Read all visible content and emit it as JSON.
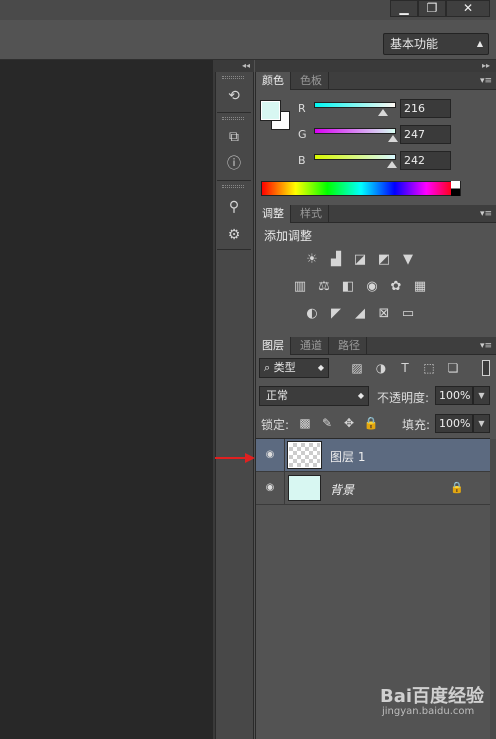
{
  "window": {
    "min_label": "▁",
    "max_label": "❐",
    "close_label": "✕"
  },
  "options_bar": {
    "workspace": "基本功能"
  },
  "color_panel": {
    "tabs": [
      "颜色",
      "色板"
    ],
    "foreground_hex": "#d8f7f2",
    "background_hex": "#ffffff",
    "channels": [
      {
        "label": "R",
        "value": "216",
        "level": 0.847,
        "gradient": "linear-gradient(to right, #00f7f2, #fff7f2)"
      },
      {
        "label": "G",
        "value": "247",
        "level": 0.969,
        "gradient": "linear-gradient(to right, #d800f2, #d8fff2)"
      },
      {
        "label": "B",
        "value": "242",
        "level": 0.949,
        "gradient": "linear-gradient(to right, #d8f700, #d8f7ff)"
      }
    ]
  },
  "adjustments_panel": {
    "tabs": [
      "调整",
      "样式"
    ],
    "title": "添加调整",
    "icons": [
      [
        "brightness-icon",
        "levels-icon",
        "curves-icon",
        "exposure-icon",
        "vibrance-icon"
      ],
      [
        "hue-saturation-icon",
        "color-balance-icon",
        "black-white-icon",
        "photo-filter-icon",
        "channel-mixer-icon",
        "color-lookup-icon"
      ],
      [
        "invert-icon",
        "posterize-icon",
        "threshold-icon",
        "selective-color-icon",
        "gradient-map-icon"
      ]
    ]
  },
  "layers_panel": {
    "tabs": [
      "图层",
      "通道",
      "路径"
    ],
    "filter_type": "类型",
    "blend_mode": "正常",
    "opacity_label": "不透明度:",
    "opacity_value": "100%",
    "lock_label": "锁定:",
    "fill_label": "填充:",
    "fill_value": "100%",
    "layers": [
      {
        "name": "图层 1",
        "selected": true,
        "locked": false
      },
      {
        "name": "背景",
        "selected": false,
        "locked": true
      }
    ]
  },
  "watermark": {
    "logo": "Bai百度经验",
    "url": "jingyan.baidu.com"
  },
  "colors": {
    "selection": "#5c6a80",
    "arrow": "#e02020"
  }
}
